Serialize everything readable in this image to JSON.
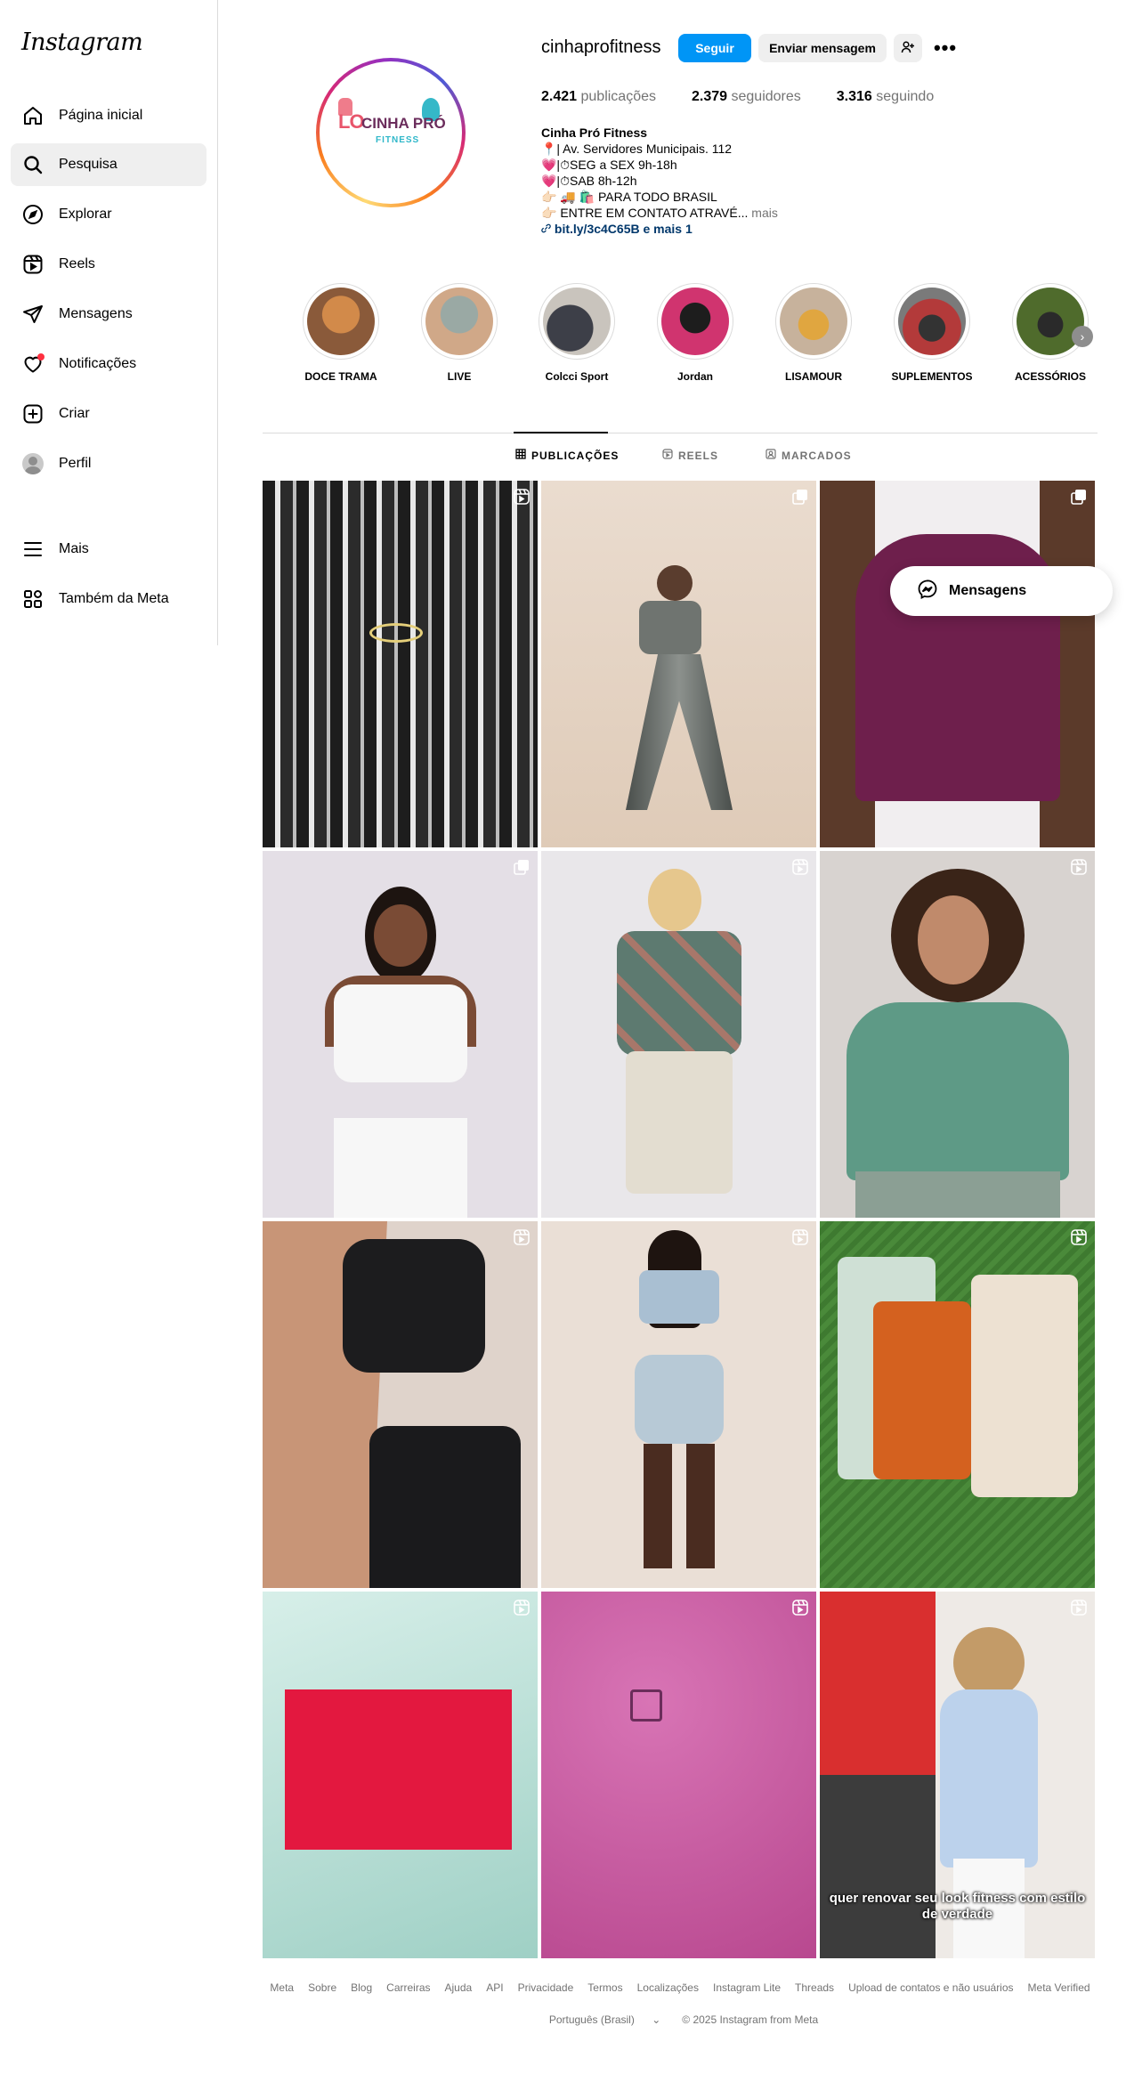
{
  "brand": {
    "logo_text": "Instagram"
  },
  "sidebar": {
    "items": [
      {
        "label": "Página inicial",
        "icon": "home-icon"
      },
      {
        "label": "Pesquisa",
        "icon": "search-icon"
      },
      {
        "label": "Explorar",
        "icon": "compass-icon"
      },
      {
        "label": "Reels",
        "icon": "reels-icon"
      },
      {
        "label": "Mensagens",
        "icon": "paper-plane-icon"
      },
      {
        "label": "Notificações",
        "icon": "heart-icon"
      },
      {
        "label": "Criar",
        "icon": "plus-square-icon"
      },
      {
        "label": "Perfil",
        "icon": "avatar"
      },
      {
        "label": "Mais",
        "icon": "menu-icon"
      },
      {
        "label": "Também da Meta",
        "icon": "meta-apps-icon"
      }
    ],
    "active_item": "Pesquisa"
  },
  "profile": {
    "username": "cinhaprofitness",
    "follow_label": "Seguir",
    "message_label": "Enviar mensagem",
    "more_label": "•••",
    "stats": {
      "posts_count": "2.421",
      "posts_label": "publicações",
      "followers_count": "2.379",
      "followers_label": "seguidores",
      "following_count": "3.316",
      "following_label": "seguindo"
    },
    "bio": {
      "name": "Cinha Pró Fitness",
      "line1": "📍| Av. Servidores Municipais. 112",
      "line2": "💗|⏱SEG a SEX 9h-18h",
      "line3": "💗|⏱SAB 8h-12h",
      "line4": "👉🏻 🚚 🛍️ PARA TODO BRASIL",
      "line5": "👉🏻 ENTRE EM CONTATO ATRAVÉ...",
      "more": "mais",
      "link": "bit.ly/3c4C65B e mais 1"
    },
    "pic_text": {
      "line1": "LO",
      "line2": "CINHA PRÓ",
      "line3": "FITNESS"
    }
  },
  "highlights": [
    {
      "label": "DOCE TRAMA",
      "color": "#c0773a"
    },
    {
      "label": "LIVE",
      "color": "#7a8b86"
    },
    {
      "label": "Colcci Sport",
      "color": "#3d3f48"
    },
    {
      "label": "Jordan",
      "color": "#d0346f"
    },
    {
      "label": "LISAMOUR",
      "color": "#e0a640"
    },
    {
      "label": "SUPLEMENTOS",
      "color": "#b33a3a"
    },
    {
      "label": "ACESSÓRIOS",
      "color": "#4f6b2c"
    }
  ],
  "tabs": [
    {
      "label": "PUBLICAÇÕES",
      "icon": "grid-icon"
    },
    {
      "label": "REELS",
      "icon": "reels-icon"
    },
    {
      "label": "MARCADOS",
      "icon": "tagged-icon"
    }
  ],
  "posts": [
    {
      "type": "reel",
      "bg": "#3a3a3a"
    },
    {
      "type": "carousel",
      "bg": "#e7d6c6"
    },
    {
      "type": "carousel",
      "bg": "#f0edf0"
    },
    {
      "type": "carousel",
      "bg": "#e6e1e8"
    },
    {
      "type": "reel",
      "bg": "#e6e4e7"
    },
    {
      "type": "reel",
      "bg": "#d9d5d2"
    },
    {
      "type": "reel",
      "bg": "#e0d6cf"
    },
    {
      "type": "reel",
      "bg": "#e9dfd6"
    },
    {
      "type": "reel",
      "bg": "#4c7d3a"
    },
    {
      "type": "reel",
      "bg": "#b8ddd6"
    },
    {
      "type": "reel",
      "bg": "#cf5fa8"
    },
    {
      "type": "reel",
      "bg": "#e9e7e4",
      "caption": "quer renovar seu look fitness com estilo de verdade"
    }
  ],
  "messages_float": {
    "label": "Mensagens"
  },
  "footer": {
    "links": [
      "Meta",
      "Sobre",
      "Blog",
      "Carreiras",
      "Ajuda",
      "API",
      "Privacidade",
      "Termos",
      "Localizações",
      "Instagram Lite",
      "Threads",
      "Upload de contatos e não usuários",
      "Meta Verified"
    ],
    "language": "Português (Brasil)",
    "copyright": "© 2025 Instagram from Meta"
  }
}
